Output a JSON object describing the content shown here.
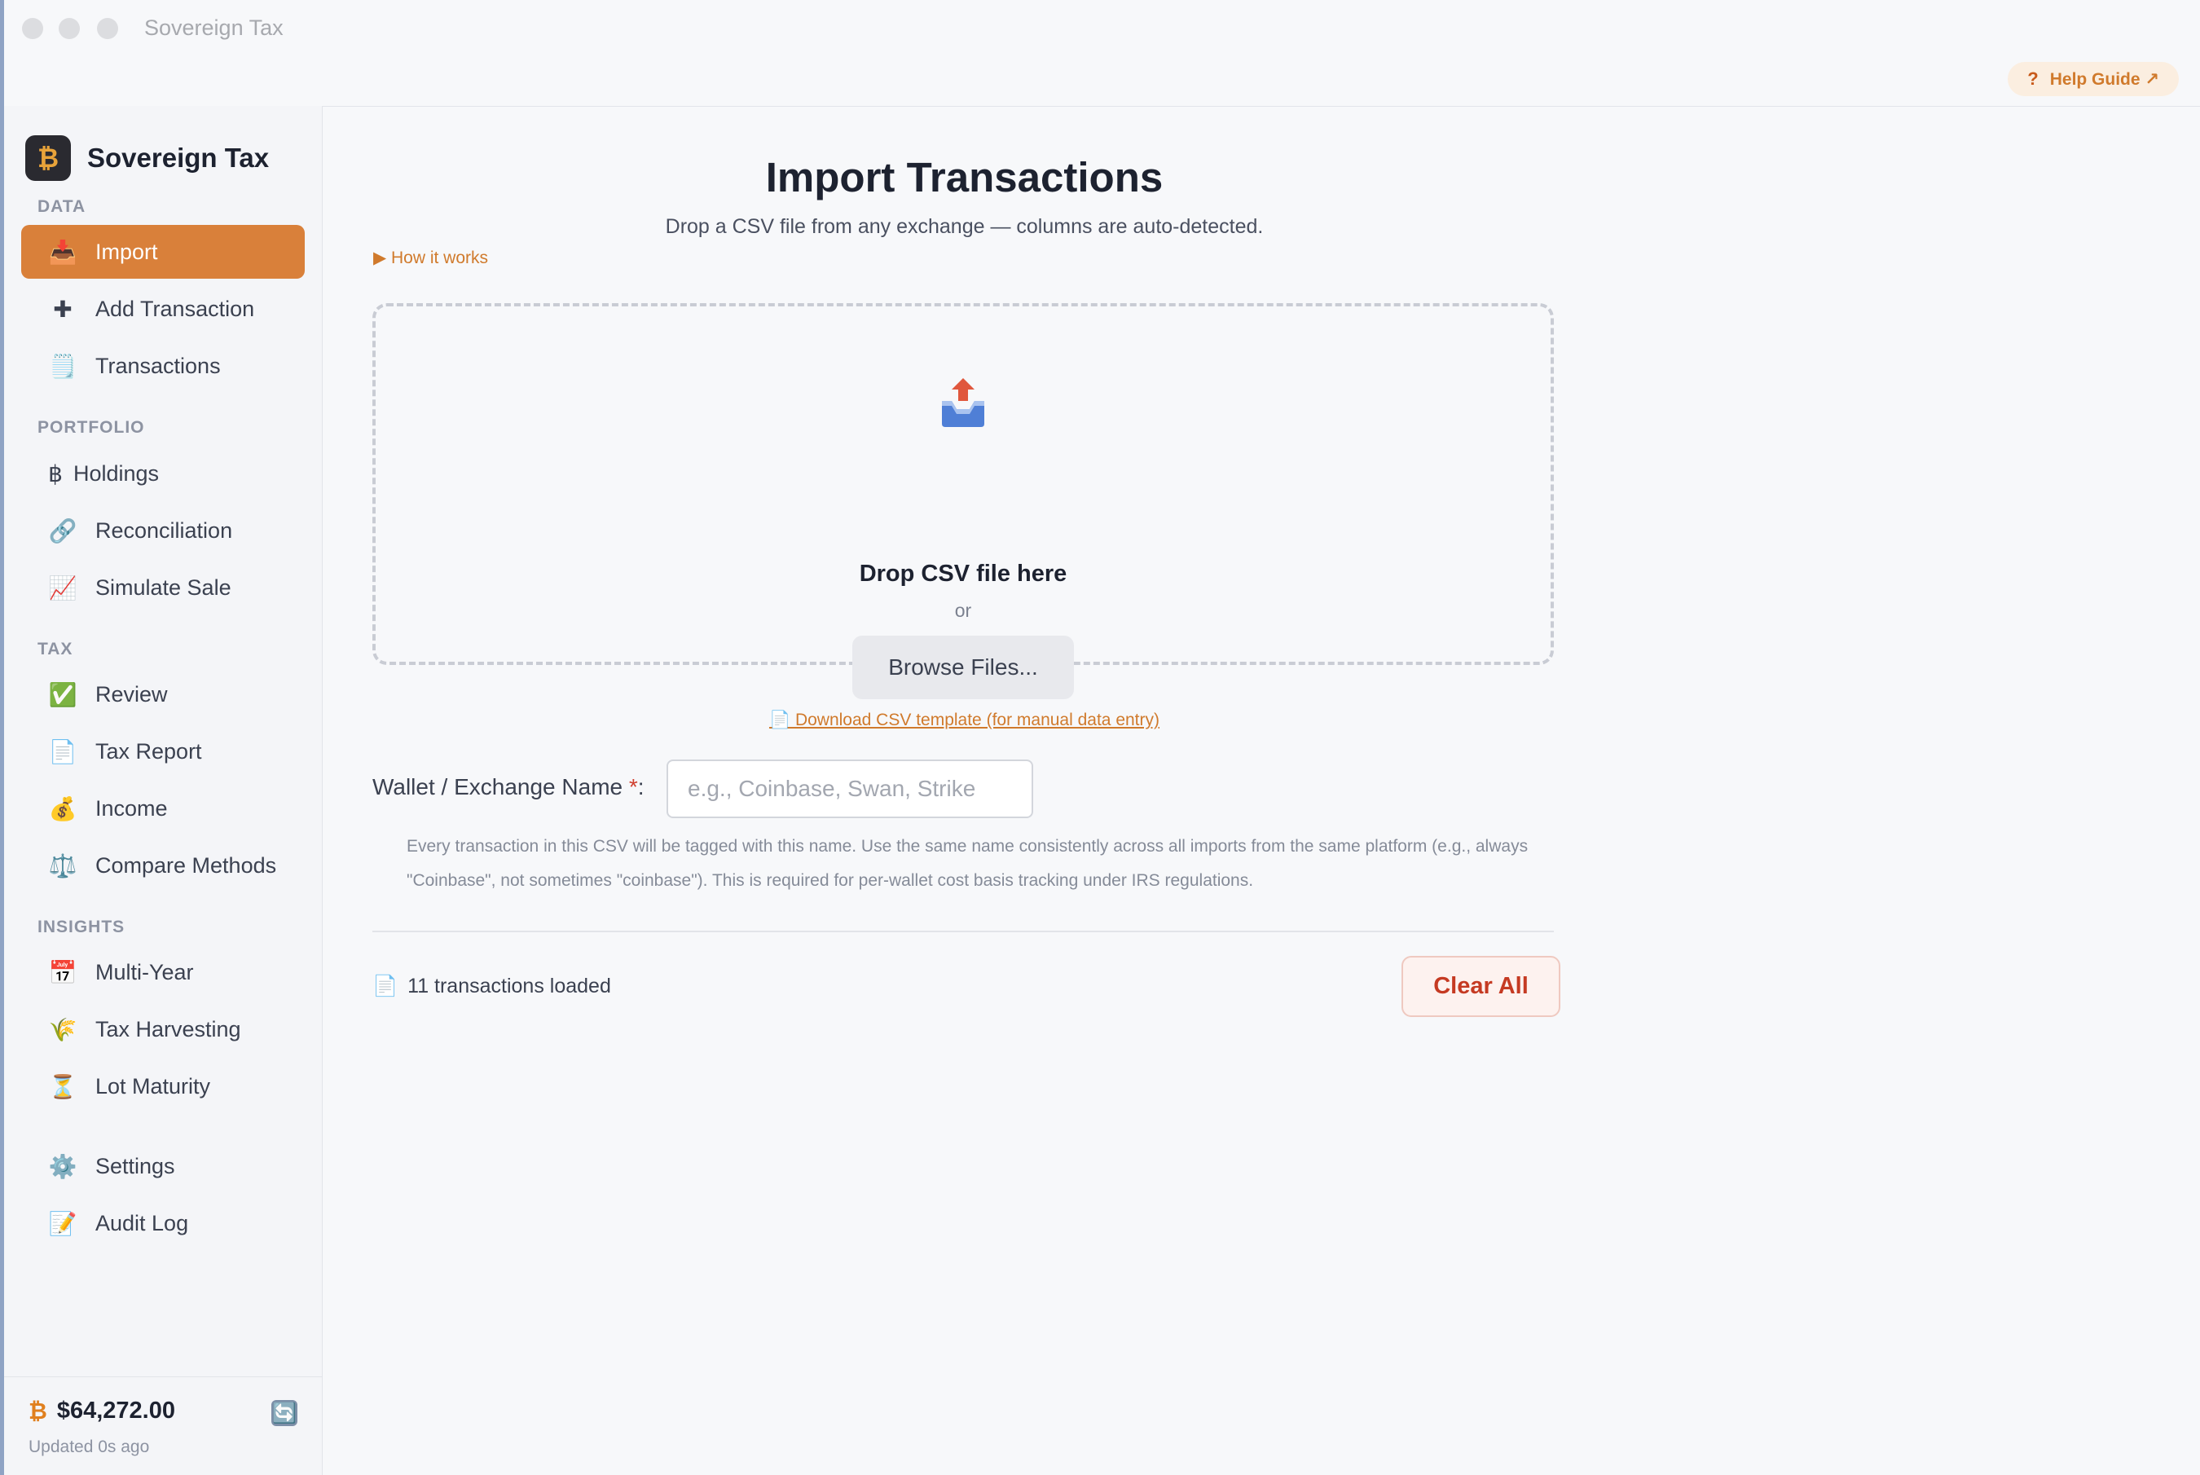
{
  "window": {
    "title": "Sovereign Tax"
  },
  "header": {
    "help_label": "Help Guide ↗",
    "help_icon": "?"
  },
  "sidebar": {
    "brand": {
      "name": "Sovereign Tax",
      "logo": "₿"
    },
    "sections": {
      "data": "DATA",
      "portfolio": "PORTFOLIO",
      "tax": "TAX",
      "insights": "INSIGHTS"
    },
    "items": {
      "import": {
        "label": "Import",
        "icon": "📥"
      },
      "add_transaction": {
        "label": "Add Transaction",
        "icon": "✚"
      },
      "transactions": {
        "label": "Transactions",
        "icon": "🗒️"
      },
      "holdings": {
        "label": "Holdings",
        "icon": "฿"
      },
      "reconciliation": {
        "label": "Reconciliation",
        "icon": "🔗"
      },
      "simulate_sale": {
        "label": "Simulate Sale",
        "icon": "📈"
      },
      "review": {
        "label": "Review",
        "icon": "✅"
      },
      "tax_report": {
        "label": "Tax Report",
        "icon": "📄"
      },
      "income": {
        "label": "Income",
        "icon": "💰"
      },
      "compare_methods": {
        "label": "Compare Methods",
        "icon": "⚖️"
      },
      "multi_year": {
        "label": "Multi-Year",
        "icon": "📅"
      },
      "tax_harvesting": {
        "label": "Tax Harvesting",
        "icon": "🌾"
      },
      "lot_maturity": {
        "label": "Lot Maturity",
        "icon": "⏳"
      },
      "settings": {
        "label": "Settings",
        "icon": "⚙️"
      },
      "audit_log": {
        "label": "Audit Log",
        "icon": "📝"
      }
    },
    "footer": {
      "btc_symbol": "₿",
      "btc_price": "$64,272.00",
      "updated": "Updated 0s ago",
      "refresh_icon": "🔄"
    }
  },
  "main": {
    "title": "Import Transactions",
    "subtitle": "Drop a CSV file from any exchange — columns are auto-detected.",
    "how_it_works": "▶ How it works",
    "dropzone": {
      "title": "Drop CSV file here",
      "or": "or",
      "browse_label": "Browse Files..."
    },
    "download_template": "📄 Download CSV template (for manual data entry)",
    "wallet": {
      "label": "Wallet / Exchange Name",
      "required_mark": "*",
      "colon": ":",
      "value": "",
      "placeholder": "e.g., Coinbase, Swan, Strike",
      "help": "Every transaction in this CSV will be tagged with this name. Use the same name consistently across all imports from the same platform (e.g., always \"Coinbase\", not sometimes \"coinbase\"). This is required for per-wallet cost basis tracking under IRS regulations."
    },
    "status": {
      "icon": "📄",
      "loaded_text": "11 transactions loaded"
    },
    "clear_all_label": "Clear All"
  },
  "colors": {
    "accent": "#d9803a",
    "danger": "#c53a22",
    "link": "#d07a2c"
  }
}
